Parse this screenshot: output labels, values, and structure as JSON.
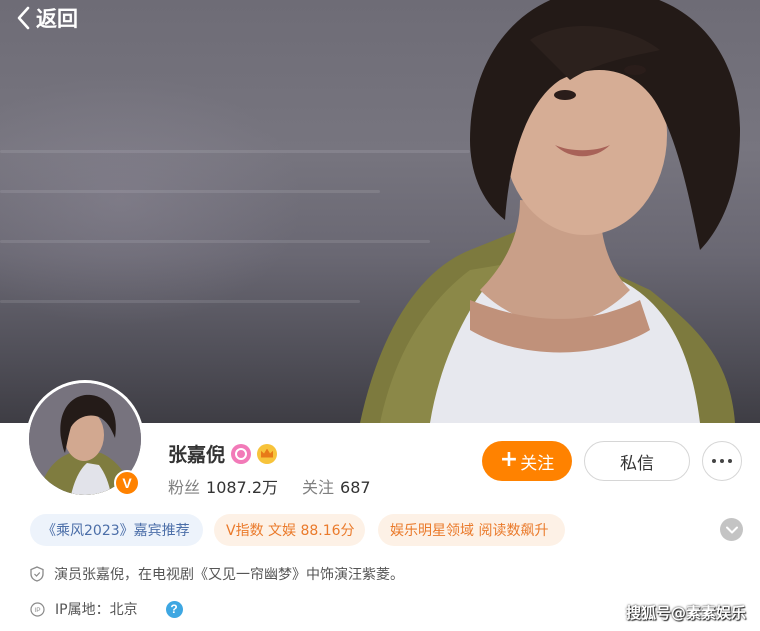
{
  "header": {
    "back_label": "返回"
  },
  "profile": {
    "name": "张嘉倪",
    "verified_badge": "V",
    "fans_label": "粉丝",
    "fans_count": "1087.2万",
    "following_label": "关注",
    "following_count": "687"
  },
  "actions": {
    "follow_plus": "+",
    "follow_label": "关注",
    "message_label": "私信"
  },
  "tags": [
    {
      "text": "《乘风2023》嘉宾推荐"
    },
    {
      "text": "V指数 文娱 88.16分"
    },
    {
      "text": "娱乐明星领域 阅读数飙升"
    }
  ],
  "bio": "演员张嘉倪，在电视剧《又见一帘幽梦》中饰演汪紫菱。",
  "ip": {
    "icon_text": "IP",
    "label": "IP属地：北京",
    "help_symbol": "?"
  },
  "watermark": "搜狐号@素素娱乐",
  "colors": {
    "accent": "#ff8200",
    "tag_blue": "#4b6ea8",
    "tag_orange": "#ea7a2b",
    "help_blue": "#3ea7e2"
  },
  "icons": [
    "back-chevron-icon",
    "pink-badge-icon",
    "crown-badge-icon",
    "more-dots-icon",
    "expand-chevron-icon",
    "shield-icon",
    "ip-icon",
    "help-icon"
  ]
}
